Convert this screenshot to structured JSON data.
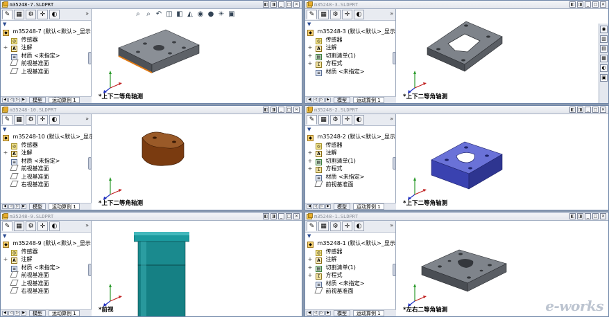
{
  "toolbar_icons": [
    "zoom-to-fit-icon",
    "zoom-area-icon",
    "previous-view-icon",
    "section-view-icon",
    "view-orientation-icon",
    "display-style-icon",
    "hide-show-icon",
    "edit-appearance-icon",
    "apply-scene-icon",
    "view-settings-icon"
  ],
  "fm_tabs": [
    "feature-manager-tab",
    "property-manager-tab",
    "configuration-manager-tab",
    "dimxpert-manager-tab",
    "display-manager-tab"
  ],
  "fm_more": "»",
  "sheet_tabs": [
    "模型",
    "运动算例 1"
  ],
  "colors": {
    "dark_gray_part": "#5a5f66",
    "orange_edge": "#e07810",
    "brown_part": "#7a3b10",
    "blue_part": "#4a52c8",
    "teal_part": "#1a8a8e",
    "titlebar": "#d5dbe6"
  },
  "windows": [
    {
      "title": "m35248-7.SLDPRT",
      "active": true,
      "root": "m35248-7  (默认<默认>_显示",
      "nodes": [
        {
          "label": "传感器",
          "icon": "sensor-icon",
          "exp": ""
        },
        {
          "label": "注解",
          "icon": "annotations-icon",
          "exp": "+"
        },
        {
          "label": "材质 <未指定>",
          "icon": "material-icon",
          "exp": ""
        },
        {
          "label": "前视基准面",
          "icon": "plane-icon",
          "exp": ""
        },
        {
          "label": "上视基准面",
          "icon": "plane-icon",
          "exp": ""
        }
      ],
      "view": "*上下二等角轴测",
      "model": "gray-plate-orange-edge"
    },
    {
      "title": "m35248-3.SLDPRT",
      "active": false,
      "root": "m35248-3  (默认<默认>_显示",
      "nodes": [
        {
          "label": "传感器",
          "icon": "sensor-icon",
          "exp": ""
        },
        {
          "label": "注解",
          "icon": "annotations-icon",
          "exp": "+"
        },
        {
          "label": "切割清单(1)",
          "icon": "cut-list-icon",
          "exp": "+"
        },
        {
          "label": "方程式",
          "icon": "equations-icon",
          "exp": "+"
        },
        {
          "label": "材质 <未指定>",
          "icon": "material-icon",
          "exp": ""
        }
      ],
      "view": "*上下二等角轴测",
      "model": "gray-bracket"
    },
    {
      "title": "m35248-10.SLDPRT",
      "active": false,
      "root": "m35248-10  (默认<默认>_显示",
      "nodes": [
        {
          "label": "传感器",
          "icon": "sensor-icon",
          "exp": ""
        },
        {
          "label": "注解",
          "icon": "annotations-icon",
          "exp": "+"
        },
        {
          "label": "材质 <未指定>",
          "icon": "material-icon",
          "exp": ""
        },
        {
          "label": "前视基准面",
          "icon": "plane-icon",
          "exp": ""
        },
        {
          "label": "上视基准面",
          "icon": "plane-icon",
          "exp": ""
        },
        {
          "label": "右视基准面",
          "icon": "plane-icon",
          "exp": ""
        }
      ],
      "view": "*上下二等角轴测",
      "model": "brown-block"
    },
    {
      "title": "m35248-2.SLDPRT",
      "active": false,
      "root": "m35248-2  (默认<默认>_显示",
      "nodes": [
        {
          "label": "传感器",
          "icon": "sensor-icon",
          "exp": ""
        },
        {
          "label": "注解",
          "icon": "annotations-icon",
          "exp": "+"
        },
        {
          "label": "切割清单(1)",
          "icon": "cut-list-icon",
          "exp": "+"
        },
        {
          "label": "方程式",
          "icon": "equations-icon",
          "exp": "+"
        },
        {
          "label": "材质 <未指定>",
          "icon": "material-icon",
          "exp": ""
        },
        {
          "label": "前视基准面",
          "icon": "plane-icon",
          "exp": ""
        }
      ],
      "view": "*上下二等角轴测",
      "model": "blue-block"
    },
    {
      "title": "m35248-9.SLDPRT",
      "active": false,
      "root": "m35248-9  (默认<默认>_显示",
      "nodes": [
        {
          "label": "传感器",
          "icon": "sensor-icon",
          "exp": ""
        },
        {
          "label": "注解",
          "icon": "annotations-icon",
          "exp": "+"
        },
        {
          "label": "材质 <未指定>",
          "icon": "material-icon",
          "exp": ""
        },
        {
          "label": "前视基准面",
          "icon": "plane-icon",
          "exp": ""
        },
        {
          "label": "上视基准面",
          "icon": "plane-icon",
          "exp": ""
        },
        {
          "label": "右视基准面",
          "icon": "plane-icon",
          "exp": ""
        }
      ],
      "view": "*前视",
      "model": "teal-cylinder"
    },
    {
      "title": "m35248-1.SLDPRT",
      "active": false,
      "root": "m35248-1  (默认<默认>_显示",
      "nodes": [
        {
          "label": "传感器",
          "icon": "sensor-icon",
          "exp": ""
        },
        {
          "label": "注解",
          "icon": "annotations-icon",
          "exp": "+"
        },
        {
          "label": "切割清单(1)",
          "icon": "cut-list-icon",
          "exp": "+"
        },
        {
          "label": "方程式",
          "icon": "equations-icon",
          "exp": "+"
        },
        {
          "label": "材质 <未指定>",
          "icon": "material-icon",
          "exp": ""
        },
        {
          "label": "前视基准面",
          "icon": "plane-icon",
          "exp": ""
        }
      ],
      "view": "*左右二等角轴测",
      "model": "gray-plate"
    }
  ],
  "task_pane_icons": [
    "solidworks-resources-icon",
    "design-library-icon",
    "file-explorer-icon",
    "view-palette-icon",
    "appearances-icon",
    "custom-properties-icon"
  ],
  "watermark": "e-works"
}
